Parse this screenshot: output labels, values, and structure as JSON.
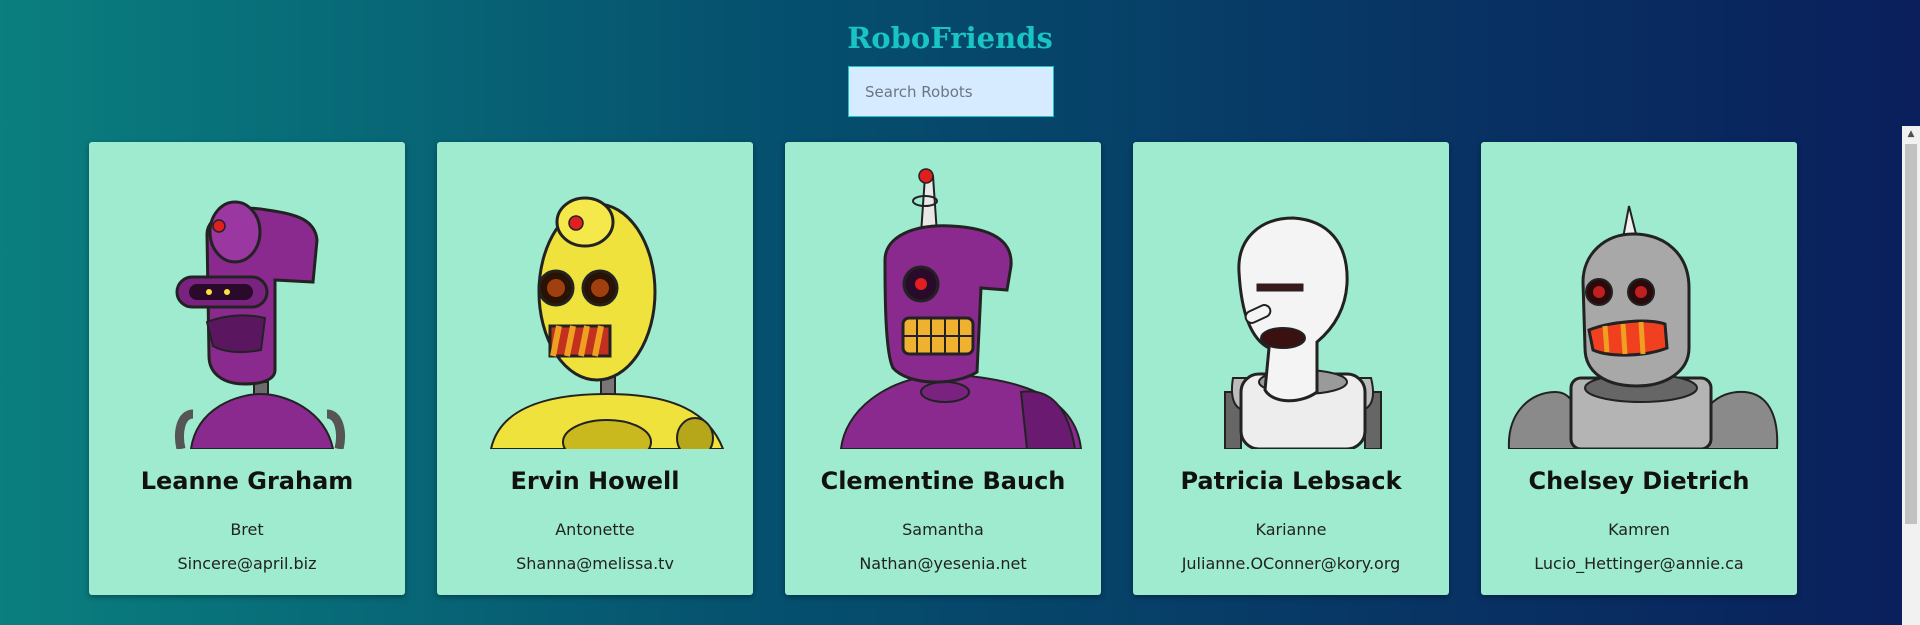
{
  "app": {
    "title": "RoboFriends"
  },
  "search": {
    "placeholder": "Search Robots",
    "value": ""
  },
  "robots": [
    {
      "name": "Leanne Graham",
      "username": "Bret",
      "email": "Sincere@april.biz",
      "color": "#8a2a8f"
    },
    {
      "name": "Ervin Howell",
      "username": "Antonette",
      "email": "Shanna@melissa.tv",
      "color": "#f0e23c"
    },
    {
      "name": "Clementine Bauch",
      "username": "Samantha",
      "email": "Nathan@yesenia.net",
      "color": "#8a2a8f"
    },
    {
      "name": "Patricia Lebsack",
      "username": "Karianne",
      "email": "Julianne.OConner@kory.org",
      "color": "#f2f2f2"
    },
    {
      "name": "Chelsey Dietrich",
      "username": "Kamren",
      "email": "Lucio_Hettinger@annie.ca",
      "color": "#9a9a9a"
    }
  ],
  "colors": {
    "card_bg": "#9eebd0",
    "title": "#19c4c4"
  }
}
